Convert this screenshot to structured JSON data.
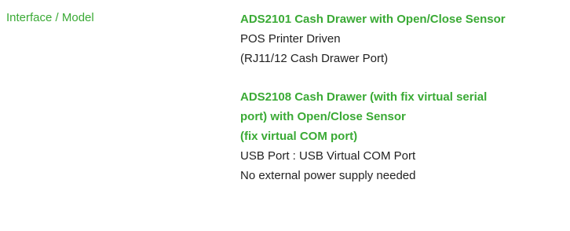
{
  "spec": {
    "label": "Interface / Model",
    "model1": {
      "title": "ADS2101 Cash Drawer with Open/Close Sensor",
      "lines": [
        "POS Printer Driven",
        "(RJ11/12 Cash Drawer Port)"
      ]
    },
    "model2": {
      "title_lines": [
        "ADS2108 Cash Drawer (with fix virtual serial",
        "port) with Open/Close Sensor",
        "(fix virtual COM port)"
      ],
      "lines": [
        "USB Port : USB Virtual COM Port",
        "No external power supply needed"
      ]
    }
  },
  "colors": {
    "accent_green": "#3aaa35",
    "text": "#222222",
    "background": "#ffffff"
  }
}
